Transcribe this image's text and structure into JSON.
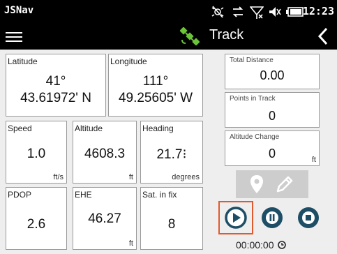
{
  "statusbar": {
    "app_title": "JSNav",
    "time": "12:23",
    "icons": [
      "gps-off-icon",
      "data-sync-icon",
      "signal-no-connection-icon",
      "volume-muted-icon",
      "battery-icon"
    ]
  },
  "toolbar": {
    "title": "Track",
    "icons": [
      "menu-icon",
      "satellite-icon",
      "back-chevron-icon"
    ]
  },
  "fields": {
    "latitude": {
      "label": "Latitude",
      "line1": "41°",
      "line2": "43.61972' N"
    },
    "longitude": {
      "label": "Longitude",
      "line1": "111°",
      "line2": "49.25605' W"
    },
    "speed": {
      "label": "Speed",
      "value": "1.0",
      "unit": "ft/s"
    },
    "altitude": {
      "label": "Altitude",
      "value": "4608.3",
      "unit": "ft"
    },
    "heading": {
      "label": "Heading",
      "value": "21.7⁝",
      "unit": "degrees"
    },
    "pdop": {
      "label": "PDOP",
      "value": "2.6",
      "unit": ""
    },
    "ehe": {
      "label": "EHE",
      "value": "46.27",
      "unit": "ft"
    },
    "sat_in_fix": {
      "label": "Sat. in fix",
      "value": "8",
      "unit": ""
    }
  },
  "track": {
    "total_distance": {
      "label": "Total Distance",
      "value": "0.00"
    },
    "points": {
      "label": "Points in Track",
      "value": "0"
    },
    "altitude_change": {
      "label": "Altitude Change",
      "value": "0",
      "unit": "ft"
    }
  },
  "controls": {
    "timer": "00:00:00",
    "icons": [
      "waypoint-pin-icon",
      "edit-pencil-icon",
      "play-icon",
      "pause-icon",
      "stop-icon",
      "clock-icon"
    ],
    "colors": {
      "accent_teal": "#1d4e66",
      "icon_light": "#ffffff",
      "record_highlight": "#e05a2e",
      "button_bar": "#cdcdcd"
    }
  },
  "colors": {
    "satellite_icon": "#6cc23a"
  }
}
